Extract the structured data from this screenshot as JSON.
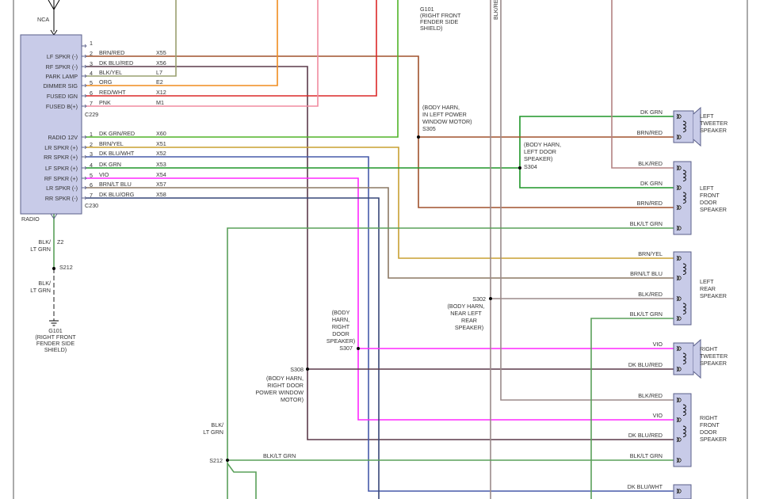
{
  "colors": {
    "brn_red": "#a0522d",
    "dk_blu_red": "#5c3a4a",
    "blk_yel": "#9aa070",
    "org": "#f08c1e",
    "red_wht": "#dc2828",
    "pnk": "#f08ca0",
    "dk_grn_red": "#50b428",
    "brn_yel": "#c8a032",
    "dk_blu_wht": "#465aaa",
    "dk_grn": "#1e9628",
    "vio": "#ff28ff",
    "brn_lt_blu": "#8c7864",
    "dk_blu_org": "#374678",
    "blk_lt_grn": "#5aa05a",
    "blk_red": "#b48282",
    "blk_red_long": "#9b8a8a",
    "speaker_fill": "#c8cbe8"
  },
  "top": {
    "nca": "NCA",
    "g101_top": [
      "G101",
      "(RIGHT FRONT",
      "FENDER SIDE",
      "SHIELD)"
    ],
    "blk_re": "BLK/RE"
  },
  "radio": {
    "label": "RADIO",
    "c229": "C229",
    "c230": "C230",
    "pins_a": [
      {
        "n": "1",
        "name": "",
        "wire": "",
        "circuit": ""
      },
      {
        "n": "2",
        "name": "LF SPKR (-)",
        "wire": "BRN/RED",
        "circuit": "X55"
      },
      {
        "n": "3",
        "name": "RF SPKR (-)",
        "wire": "DK BLU/RED",
        "circuit": "X56"
      },
      {
        "n": "4",
        "name": "PARK LAMP",
        "wire": "BLK/YEL",
        "circuit": "L7"
      },
      {
        "n": "5",
        "name": "DIMMER SIG",
        "wire": "ORG",
        "circuit": "E2"
      },
      {
        "n": "6",
        "name": "FUSED IGN",
        "wire": "RED/WHT",
        "circuit": "X12"
      },
      {
        "n": "7",
        "name": "FUSED B(+)",
        "wire": "PNK",
        "circuit": "M1"
      }
    ],
    "pins_b": [
      {
        "n": "1",
        "name": "RADIO 12V",
        "wire": "DK GRN/RED",
        "circuit": "X60"
      },
      {
        "n": "2",
        "name": "LR SPKR (+)",
        "wire": "BRN/YEL",
        "circuit": "X51"
      },
      {
        "n": "3",
        "name": "RR SPKR (+)",
        "wire": "DK BLU/WHT",
        "circuit": "X52"
      },
      {
        "n": "4",
        "name": "LF SPKR (+)",
        "wire": "DK GRN",
        "circuit": "X53"
      },
      {
        "n": "5",
        "name": "RF SPKR (+)",
        "wire": "VIO",
        "circuit": "X54"
      },
      {
        "n": "6",
        "name": "LR SPKR (-)",
        "wire": "BRN/LT BLU",
        "circuit": "X57"
      },
      {
        "n": "7",
        "name": "RR SPKR (-)",
        "wire": "DK BLU/ORG",
        "circuit": "X58"
      }
    ]
  },
  "ground": {
    "wire1": [
      "BLK/",
      "LT GRN"
    ],
    "z2": "Z2",
    "s212": "S212",
    "wire2": [
      "BLK/",
      "LT GRN"
    ],
    "g101": [
      "G101",
      "(RIGHT FRONT",
      "FENDER SIDE",
      "SHIELD)"
    ]
  },
  "splices": {
    "s305": [
      "(BODY HARN,",
      "IN LEFT POWER",
      "WINDOW MOTOR)",
      "S305"
    ],
    "s304": [
      "(BODY HARN,",
      "LEFT DOOR",
      "SPEAKER)",
      "S304"
    ],
    "s302": [
      "S302",
      "(BODY HARN,",
      "NEAR LEFT",
      "REAR",
      "SPEAKER)"
    ],
    "s307": [
      "(BODY",
      "HARN,",
      "RIGHT",
      "DOOR",
      "SPEAKER)",
      "S307"
    ],
    "s308": [
      "S308",
      "(BODY HARN,",
      "RIGHT DOOR",
      "POWER WINDOW",
      "MOTOR)"
    ],
    "s212b": "S212",
    "s212b_wire": [
      "BLK/",
      "LT GRN"
    ]
  },
  "speakers": {
    "left_tweeter": {
      "name": [
        "LEFT",
        "TWEETER",
        "SPEAKER"
      ],
      "wires": [
        "DK GRN",
        "BRN/RED"
      ]
    },
    "left_front_door": {
      "name": [
        "LEFT",
        "FRONT",
        "DOOR",
        "SPEAKER"
      ],
      "wires": [
        "BLK/RED",
        "DK GRN",
        "BRN/RED",
        "BLK/LT GRN"
      ]
    },
    "left_rear": {
      "name": [
        "LEFT",
        "REAR",
        "SPEAKER"
      ],
      "wires": [
        "BRN/YEL",
        "BRN/LT BLU",
        "BLK/RED",
        "BLK/LT GRN"
      ]
    },
    "right_tweeter": {
      "name": [
        "RIGHT",
        "TWEETER",
        "SPEAKER"
      ],
      "wires": [
        "VIO",
        "DK BLU/RED"
      ]
    },
    "right_front_door": {
      "name": [
        "RIGHT",
        "FRONT",
        "DOOR",
        "SPEAKER"
      ],
      "wires": [
        "BLK/RED",
        "VIO",
        "DK BLU/RED",
        "BLK/LT GRN"
      ]
    },
    "bottom": {
      "wires": [
        "DK BLU/WHT"
      ]
    },
    "s212_row_wire": "BLK/LT GRN"
  }
}
